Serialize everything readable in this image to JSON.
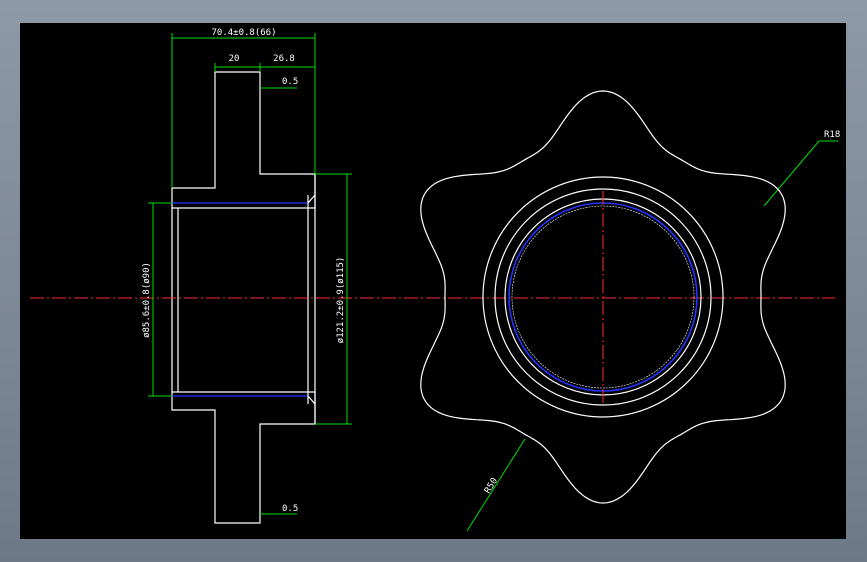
{
  "drawing": {
    "dimensions": {
      "overall_length": "70.4±0.8(66)",
      "flange_width": "20",
      "hub_length": "26.8",
      "chamfer_top": "0.5",
      "chamfer_bottom": "0.5",
      "inner_diameter": "ø85.6±0.8(ø90)",
      "outer_diameter": "ø121.2±0.9(ø115)",
      "radius_tip": "R18",
      "radius_root": "R50"
    },
    "colors": {
      "background": "#000000",
      "outline": "#ffffff",
      "dimension": "#00dd00",
      "centerline": "#ff2a2a",
      "hatch": "#00c8e6",
      "bore": "#2233ff"
    }
  }
}
